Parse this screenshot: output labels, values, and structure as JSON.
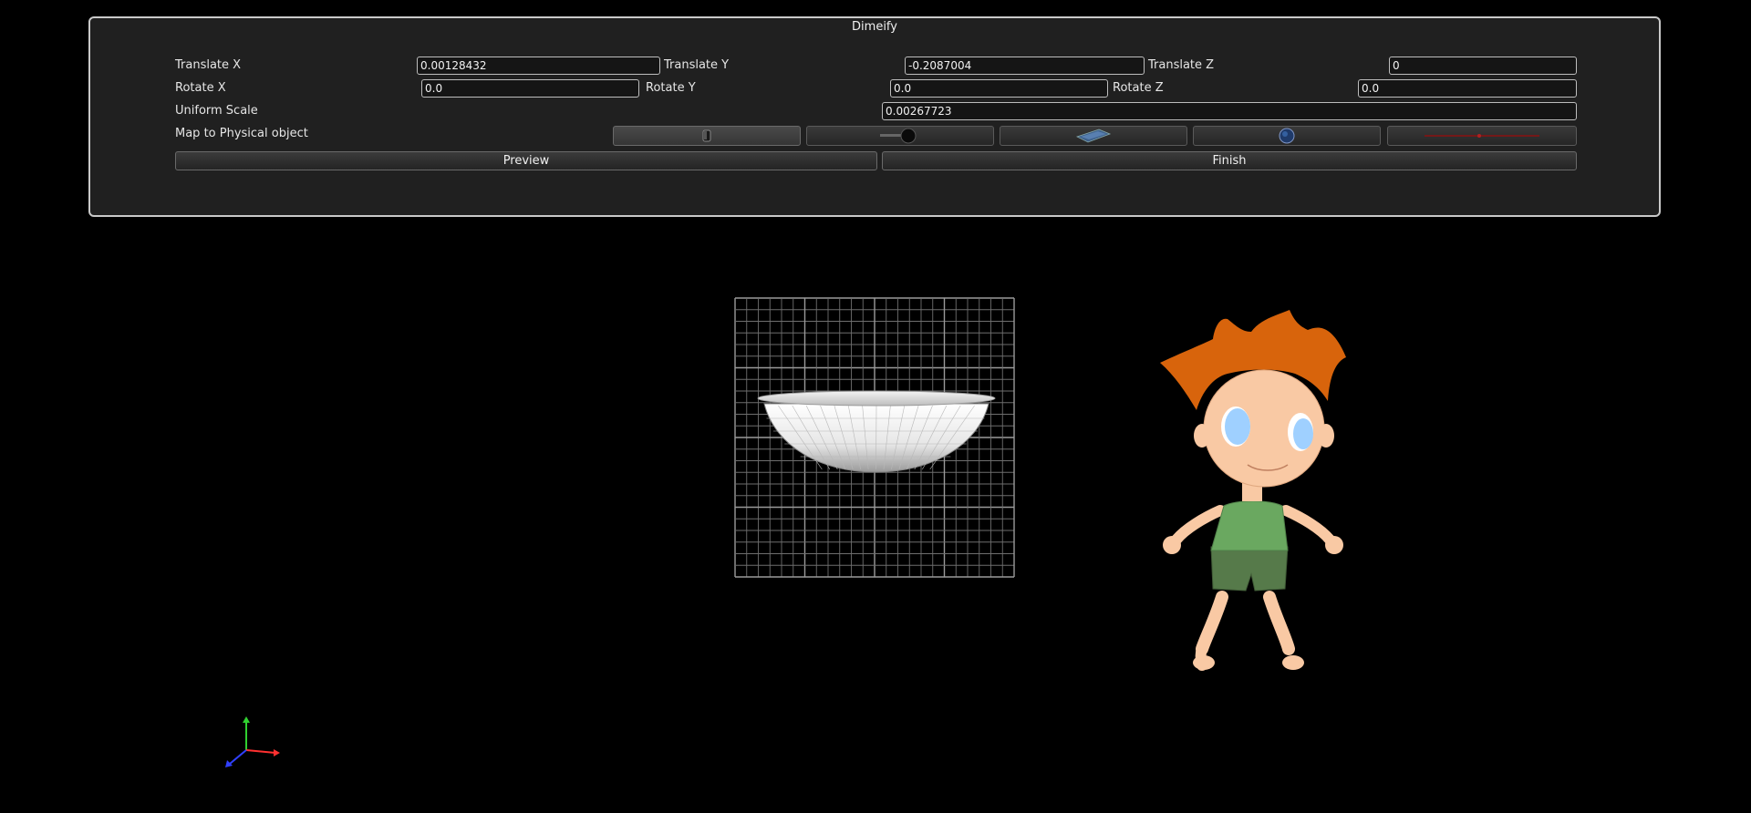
{
  "window": {
    "title": "Dimeify"
  },
  "transform": {
    "translate_x_label": "Translate X",
    "translate_x_value": "0.00128432",
    "translate_y_label": "Translate Y",
    "translate_y_value": "-0.2087004",
    "translate_z_label": "Translate Z",
    "translate_z_value": "0",
    "rotate_x_label": "Rotate X",
    "rotate_x_value": "0.0",
    "rotate_y_label": "Rotate Y",
    "rotate_y_value": "0.0",
    "rotate_z_label": "Rotate Z",
    "rotate_z_value": "0.0",
    "uniform_scale_label": "Uniform Scale",
    "uniform_scale_value": "0.00267723"
  },
  "map_to_physical": {
    "label": "Map to Physical object",
    "objects": [
      {
        "icon": "cup-icon",
        "selected": true
      },
      {
        "icon": "magnifier-icon",
        "selected": false
      },
      {
        "icon": "tablet-icon",
        "selected": false
      },
      {
        "icon": "ball-icon",
        "selected": false
      },
      {
        "icon": "wand-icon",
        "selected": false
      }
    ]
  },
  "actions": {
    "preview_label": "Preview",
    "finish_label": "Finish"
  },
  "viewport": {
    "objects": [
      "grid-plane",
      "bowl-model",
      "cartoon-boy-model",
      "axis-gizmo"
    ],
    "colors": {
      "background": "#000000",
      "hair": "#d8640c",
      "skin": "#f9c9a4",
      "shirt": "#6aa860",
      "shorts": "#567a4a",
      "eyes": "#9fd0ff",
      "axis_x": "#ff3030",
      "axis_y": "#30d030",
      "axis_z": "#3040ff"
    }
  }
}
